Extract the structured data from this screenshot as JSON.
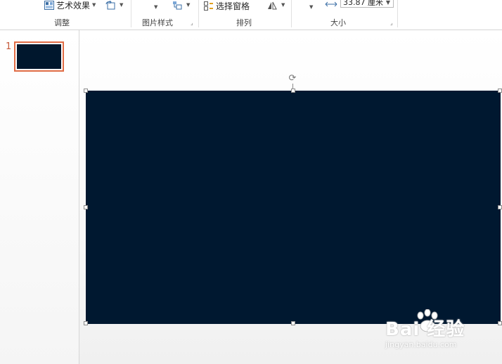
{
  "ribbon": {
    "adjust": {
      "art_effects": "艺术效果",
      "label": "调整"
    },
    "picture_styles": {
      "label": "图片样式"
    },
    "arrange": {
      "selection_pane": "选择窗格",
      "label": "排列"
    },
    "size": {
      "width_value": "33.87 厘米",
      "label": "大小"
    }
  },
  "thumbnails": [
    {
      "number": "1"
    }
  ],
  "watermark": {
    "brand": "Bai 经验",
    "url": "jingyan.baidu.com"
  },
  "colors": {
    "slide_bg": "#001830",
    "thumb_border": "#e06c45"
  }
}
